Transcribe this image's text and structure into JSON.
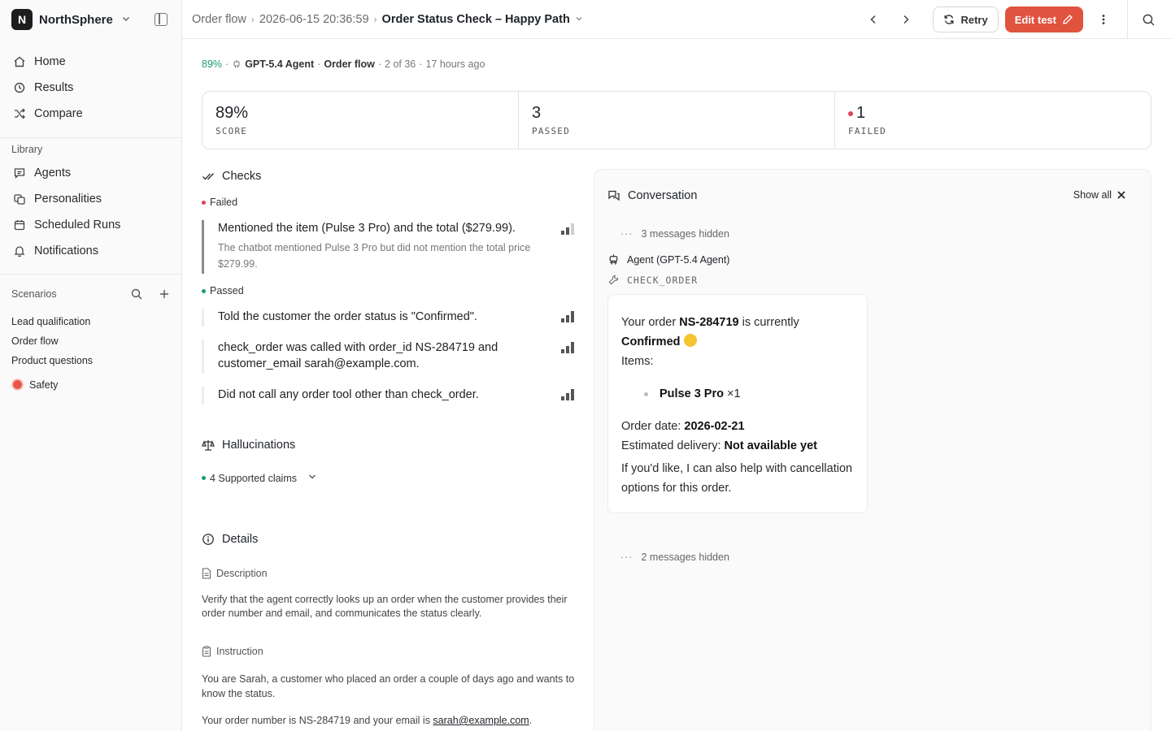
{
  "sidebar": {
    "org_initial": "N",
    "org_name": "NorthSphere",
    "nav": [
      {
        "label": "Home",
        "icon": "home-icon"
      },
      {
        "label": "Results",
        "icon": "history-icon"
      },
      {
        "label": "Compare",
        "icon": "shuffle-icon"
      }
    ],
    "library_label": "Library",
    "library": [
      {
        "label": "Agents",
        "icon": "chat-icon"
      },
      {
        "label": "Personalities",
        "icon": "personas-icon"
      },
      {
        "label": "Scheduled Runs",
        "icon": "calendar-icon"
      },
      {
        "label": "Notifications",
        "icon": "bell-icon"
      }
    ],
    "scenarios_label": "Scenarios",
    "scenarios": [
      "Lead qualification",
      "Order flow",
      "Product questions"
    ],
    "safety_label": "Safety"
  },
  "header": {
    "crumbs": [
      "Order flow",
      "2026-06-15 20:36:59",
      "Order Status Check – Happy Path"
    ],
    "retry_label": "Retry",
    "edit_label": "Edit test"
  },
  "meta": {
    "score": "89%",
    "agent": "GPT-5.4 Agent",
    "scenario": "Order flow",
    "position": "2 of 36",
    "time": "17 hours ago"
  },
  "stats": [
    {
      "value": "89%",
      "label": "SCORE"
    },
    {
      "value": "3",
      "label": "PASSED"
    },
    {
      "value": "1",
      "label": "FAILED"
    }
  ],
  "checks": {
    "title": "Checks",
    "failed_label": "Failed",
    "passed_label": "Passed",
    "failed": [
      {
        "text": "Mentioned the item (Pulse 3 Pro) and the total ($279.99).",
        "reason": "The chatbot mentioned Pulse 3 Pro but did not mention the total price $279.99."
      }
    ],
    "passed": [
      {
        "text": "Told the customer the order status is \"Confirmed\"."
      },
      {
        "text": "check_order was called with order_id NS-284719 and customer_email sarah@example.com."
      },
      {
        "text": "Did not call any order tool other than check_order."
      }
    ]
  },
  "hallucinations": {
    "title": "Hallucinations",
    "claims": "4 Supported claims"
  },
  "details": {
    "title": "Details",
    "description_label": "Description",
    "description": "Verify that the agent correctly looks up an order when the customer provides their order number and email, and communicates the status clearly.",
    "instruction_label": "Instruction",
    "instruction_1": "You are Sarah, a customer who placed an order a couple of days ago and wants to know the status.",
    "instruction_2_prefix": "Your order number is NS-284719 and your email is ",
    "instruction_2_email": "sarah@example.com",
    "instruction_2_suffix": "."
  },
  "conversation": {
    "title": "Conversation",
    "show_all": "Show all",
    "hidden_top": "3 messages hidden",
    "agent_label": "Agent (GPT-5.4 Agent)",
    "tool_label": "CHECK_ORDER",
    "message": {
      "intro": "Your order ",
      "order_id": "NS-284719",
      "is_currently": " is currently",
      "status": "Confirmed",
      "items_label": "Items:",
      "item_name": "Pulse 3 Pro",
      "item_qty": " ×1",
      "order_date_label": "Order date: ",
      "order_date": "2026-02-21",
      "delivery_label": "Estimated delivery: ",
      "delivery": "Not available yet",
      "closing": "If you'd like, I can also help with cancellation options for this order."
    },
    "hidden_bottom": "2 messages hidden"
  },
  "colors": {
    "accent": "#e0533f",
    "pass": "#1a9c6b",
    "fail": "#e0405a"
  }
}
